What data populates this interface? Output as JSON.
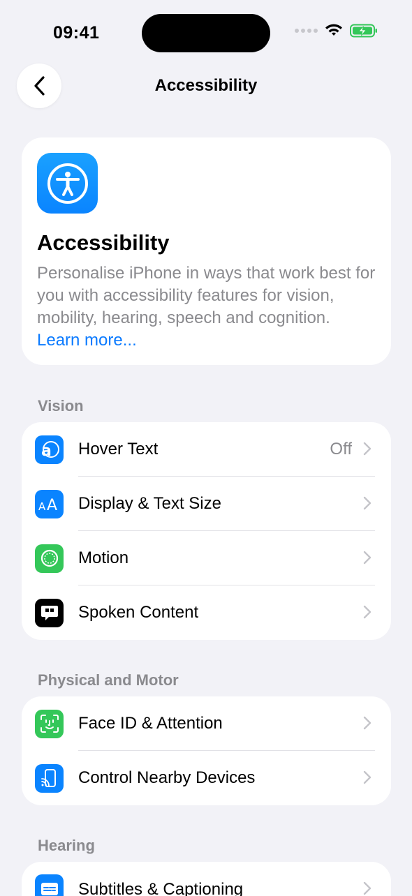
{
  "status_bar": {
    "time": "09:41"
  },
  "nav": {
    "title": "Accessibility"
  },
  "hero": {
    "title": "Accessibility",
    "description": "Personalise iPhone in ways that work best for you with accessibility features for vision, mobility, hearing, speech and cognition.",
    "link": "Learn more..."
  },
  "sections": {
    "vision": {
      "title": "Vision",
      "items": [
        {
          "label": "Hover Text",
          "value": "Off",
          "icon": "hover-text-icon"
        },
        {
          "label": "Display & Text Size",
          "value": "",
          "icon": "text-size-icon"
        },
        {
          "label": "Motion",
          "value": "",
          "icon": "motion-icon"
        },
        {
          "label": "Spoken Content",
          "value": "",
          "icon": "spoken-content-icon"
        }
      ]
    },
    "physical": {
      "title": "Physical and Motor",
      "items": [
        {
          "label": "Face ID & Attention",
          "value": "",
          "icon": "face-id-icon"
        },
        {
          "label": "Control Nearby Devices",
          "value": "",
          "icon": "nearby-devices-icon"
        }
      ]
    },
    "hearing": {
      "title": "Hearing",
      "items": [
        {
          "label": "Subtitles & Captioning",
          "value": "",
          "icon": "subtitles-icon"
        }
      ]
    }
  },
  "colors": {
    "accent": "#0a7aff",
    "blue_icon": "#0a84ff",
    "green_icon": "#34c759",
    "background": "#f2f2f7"
  }
}
